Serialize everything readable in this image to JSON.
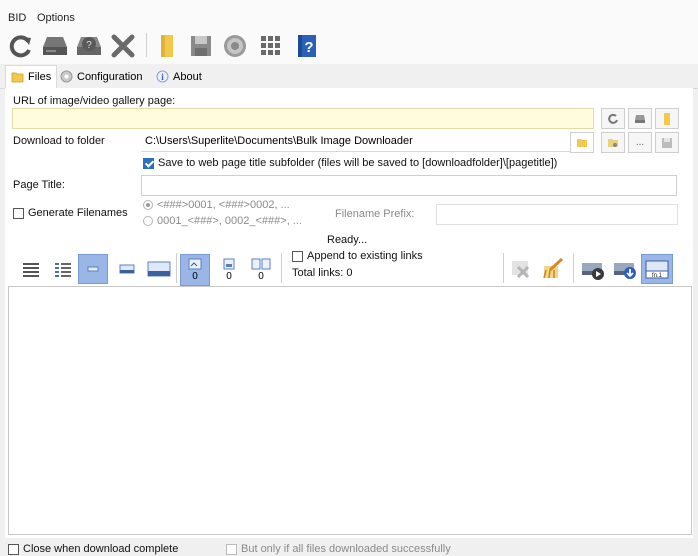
{
  "menu": {
    "items": [
      "BID",
      "Options"
    ]
  },
  "toolbar": {
    "buttons": [
      "refresh-icon",
      "drive-icon",
      "help-disk-icon",
      "close-x-icon",
      "folder-icon",
      "save-icon",
      "settings-gear-icon",
      "grid-icon",
      "help-icon"
    ],
    "colors": {
      "folder": "#f2c94c",
      "help": "#2b5fb8"
    }
  },
  "tabs": [
    {
      "label": "Files",
      "icon": "folder-icon",
      "active": true
    },
    {
      "label": "Configuration",
      "icon": "gear-icon",
      "active": false
    },
    {
      "label": "About",
      "icon": "info-icon",
      "active": false
    }
  ],
  "files": {
    "url_label": "URL of image/video gallery page:",
    "url_value": "",
    "download_label": "Download to folder",
    "download_path": "C:\\Users\\Superlite\\Documents\\Bulk Image Downloader",
    "browse_label": "...",
    "save_subfolder_label": "Save to web page title subfolder (files will be saved to [downloadfolder]\\[pagetitle])",
    "page_title_label": "Page Title:",
    "page_title_value": "",
    "generate_label": "Generate Filenames",
    "radio1_label": "<###>0001, <###>0002, ...",
    "radio2_label": "0001_<###>, 0002_<###>, ...",
    "prefix_label": "Filename Prefix:",
    "status": "Ready...",
    "append_label": "Append to existing links",
    "total_links_label": "Total links: 0",
    "counts": [
      "0",
      "0",
      "0"
    ],
    "filename_btn_label": "fn.1"
  },
  "footer": {
    "close_label": "Close when download complete",
    "only_if_label": "But only if all files downloaded successfully"
  },
  "colors": {
    "accent": "#2b6fc4",
    "url_bg": "#fffbdc",
    "selected_view": "#9ab6e6"
  }
}
